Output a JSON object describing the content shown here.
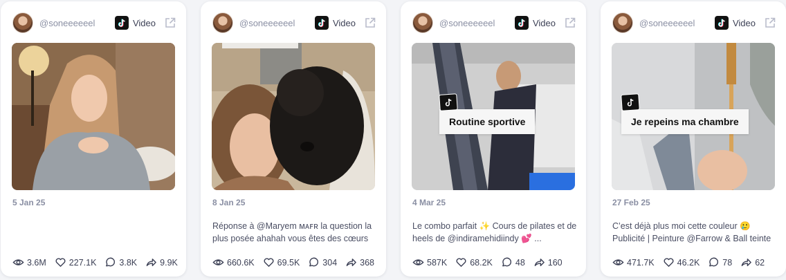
{
  "platform_label": "Video",
  "colors": {
    "card_bg": "#ffffff",
    "page_bg": "#f3f4f7",
    "muted": "#8a8fa3",
    "text": "#3c4055"
  },
  "icons": {
    "platform": "tiktok-icon",
    "external": "external-link-icon",
    "views": "eye-icon",
    "likes": "heart-icon",
    "comments": "comment-icon",
    "shares": "share-icon"
  },
  "cards": [
    {
      "handle": "@soneeeeeel",
      "date": "5 Jan 25",
      "caption": "",
      "overlay_text": "",
      "stats": {
        "views": "3.6M",
        "likes": "227.1K",
        "comments": "3.8K",
        "shares": "9.9K"
      }
    },
    {
      "handle": "@soneeeeeel",
      "date": "8 Jan 25",
      "caption": "Réponse à @Maryem ᴍᴀꜰʀ la question la plus posée ahahah vous êtes des cœurs",
      "overlay_text": "",
      "stats": {
        "views": "660.6K",
        "likes": "69.5K",
        "comments": "304",
        "shares": "368"
      }
    },
    {
      "handle": "@soneeeeeel",
      "date": "4 Mar 25",
      "caption": "Le combo parfait ✨ Cours de pilates et de heels de @indiramehidiindy 💕 ...",
      "overlay_text": "Routine sportive",
      "stats": {
        "views": "587K",
        "likes": "68.2K",
        "comments": "48",
        "shares": "160"
      }
    },
    {
      "handle": "@soneeeeeel",
      "date": "27 Feb 25",
      "caption": "C’est déjà plus moi cette couleur 🥲 Publicité | Peinture @Farrow & Ball teinte",
      "overlay_text": "Je repeins ma chambre",
      "stats": {
        "views": "471.7K",
        "likes": "46.2K",
        "comments": "78",
        "shares": "62"
      }
    }
  ]
}
